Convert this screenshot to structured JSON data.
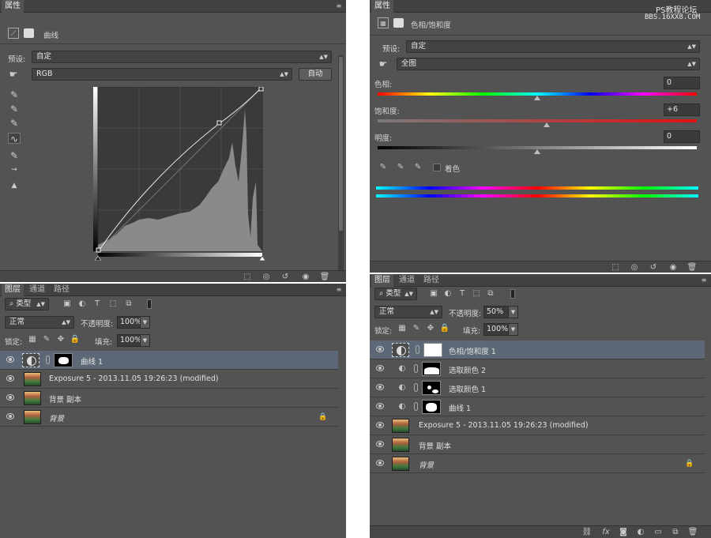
{
  "left": {
    "props_tab": "属性",
    "curves_title": "曲线",
    "preset_label": "预设:",
    "preset_value": "自定",
    "channel_value": "RGB",
    "auto_button": "自动",
    "layers_tabs": [
      "图层",
      "通道",
      "路径"
    ],
    "kind_filter": "类型",
    "blend_mode": "正常",
    "opacity_label": "不透明度:",
    "opacity_value": "100%",
    "lock_label": "锁定:",
    "fill_label": "填充:",
    "fill_value": "100%",
    "layers": [
      {
        "name": "曲线 1",
        "type": "adjustment",
        "selected": true
      },
      {
        "name": "Exposure 5 - 2013.11.05 19:26:23 (modified)",
        "type": "image"
      },
      {
        "name": "背景 副本",
        "type": "image"
      },
      {
        "name": "背景",
        "type": "image",
        "locked": true,
        "italic": true
      }
    ]
  },
  "right": {
    "props_tab": "属性",
    "watermark_line1": "PS教程论坛",
    "watermark_line2": "BBS.16XX8.COM",
    "hs_title": "色相/饱和度",
    "preset_label": "预设:",
    "preset_value": "自定",
    "range_value": "全图",
    "hue_label": "色相:",
    "hue_value": "0",
    "sat_label": "饱和度:",
    "sat_value": "+6",
    "light_label": "明度:",
    "light_value": "0",
    "colorize_label": "着色",
    "layers_tabs": [
      "图层",
      "通道",
      "路径"
    ],
    "kind_filter": "类型",
    "blend_mode": "正常",
    "opacity_label": "不透明度:",
    "opacity_value": "50%",
    "lock_label": "锁定:",
    "fill_label": "填充:",
    "fill_value": "100%",
    "layers": [
      {
        "name": "色相/饱和度 1",
        "type": "adjustment",
        "selected": true
      },
      {
        "name": "选取颜色 2",
        "type": "adjustment",
        "indent": true
      },
      {
        "name": "选取颜色 1",
        "type": "adjustment",
        "indent": true
      },
      {
        "name": "曲线 1",
        "type": "adjustment",
        "indent": true
      },
      {
        "name": "Exposure 5 - 2013.11.05 19:26:23 (modified)",
        "type": "image"
      },
      {
        "name": "背景 副本",
        "type": "image"
      },
      {
        "name": "背景",
        "type": "image",
        "locked": true,
        "italic": true
      }
    ]
  },
  "colors": {
    "panel": "#535353",
    "tabbar": "#424242",
    "selected_row": "#5d6876"
  }
}
